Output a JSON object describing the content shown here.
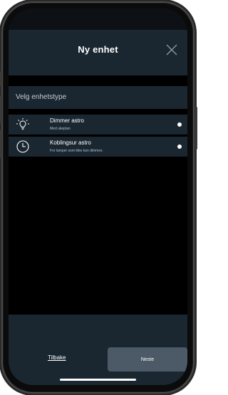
{
  "header": {
    "title": "Ny enhet",
    "close_icon": "close-icon"
  },
  "section": {
    "label": "Velg enhetstype"
  },
  "device_types": [
    {
      "icon": "lightbulb-icon",
      "title": "Dimmer astro",
      "subtitle": "Med ukeplan",
      "selected": false
    },
    {
      "icon": "clock-icon",
      "title": "Koblingsur astro",
      "subtitle": "For lamper som ikke kan dimmes",
      "selected": false
    }
  ],
  "footer": {
    "back_label": "Tilbake",
    "next_label": "Neste"
  },
  "colors": {
    "panel": "#1a2731",
    "background": "#000000",
    "button": "#4b5a66",
    "text": "#ffffff"
  }
}
